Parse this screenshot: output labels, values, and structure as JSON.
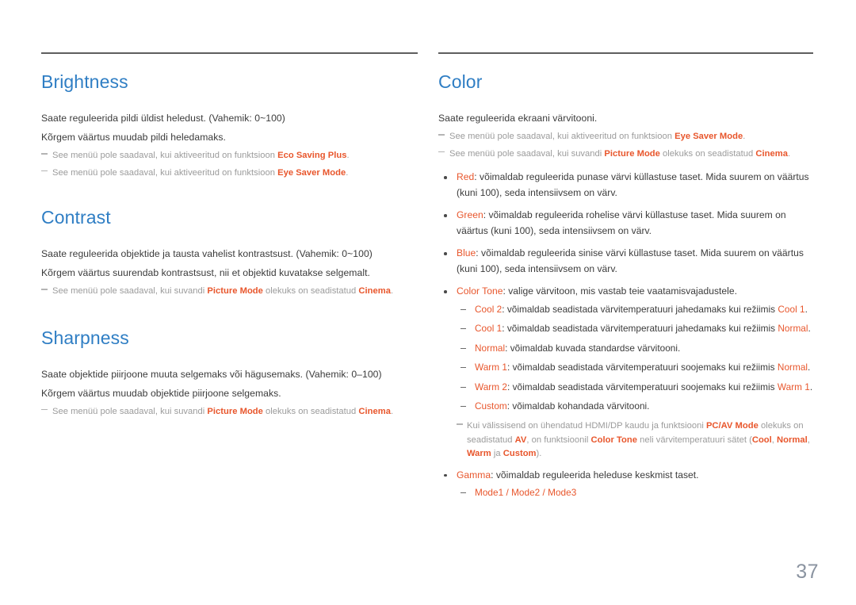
{
  "page": {
    "number": "37",
    "accent_blue": "#2f7ec4",
    "accent_orange": "#e8562c",
    "note_gray": "#9b9b9b",
    "body_gray": "#3b3b3b"
  },
  "left_column": {
    "sections": [
      {
        "title": "Brightness",
        "lines": [
          "Saate reguleerida pildi üldist heledust. (Vahemik: 0~100)",
          "Kõrgem väärtus muudab pildi heledamaks."
        ],
        "notes": [
          {
            "pre": "See menüü pole saadaval, kui aktiveeritud on funktsioon ",
            "kw": "Eco Saving Plus",
            "post": "."
          },
          {
            "pre": "See menüü pole saadaval, kui aktiveeritud on funktsioon ",
            "kw": "Eye Saver Mode",
            "post": "."
          }
        ]
      },
      {
        "title": "Contrast",
        "lines": [
          "Saate reguleerida objektide ja tausta vahelist kontrastsust. (Vahemik: 0~100)",
          "Kõrgem väärtus suurendab kontrastsust, nii et objektid kuvatakse selgemalt."
        ],
        "notes": [
          {
            "pre": "See menüü pole saadaval, kui suvandi ",
            "kw": "Picture Mode",
            "mid": " olekuks on seadistatud ",
            "kw2": "Cinema",
            "post": "."
          }
        ]
      },
      {
        "title": "Sharpness",
        "lines": [
          "Saate objektide piirjoone muuta selgemaks või hägusemaks. (Vahemik: 0–100)",
          "Kõrgem väärtus muudab objektide piirjoone selgemaks."
        ],
        "notes": [
          {
            "pre": "See menüü pole saadaval, kui suvandi ",
            "kw": "Picture Mode",
            "mid": " olekuks on seadistatud ",
            "kw2": "Cinema",
            "post": "."
          }
        ]
      }
    ]
  },
  "right_column": {
    "title": "Color",
    "intro": "Saate reguleerida ekraani värvitooni.",
    "notes": [
      {
        "pre": "See menüü pole saadaval, kui aktiveeritud on funktsioon ",
        "kw": "Eye Saver Mode",
        "post": "."
      },
      {
        "pre": "See menüü pole saadaval, kui suvandi ",
        "kw": "Picture Mode",
        "mid": " olekuks on seadistatud ",
        "kw2": "Cinema",
        "post": "."
      }
    ],
    "bullets": [
      {
        "kw": "Red",
        "text": ": võimaldab reguleerida punase värvi küllastuse taset. Mida suurem on väärtus (kuni 100), seda intensiivsem on värv."
      },
      {
        "kw": "Green",
        "text": ": võimaldab reguleerida rohelise värvi küllastuse taset. Mida suurem on väärtus (kuni 100), seda intensiivsem on värv."
      },
      {
        "kw": "Blue",
        "text": ": võimaldab reguleerida sinise värvi küllastuse taset. Mida suurem on väärtus (kuni 100), seda intensiivsem on värv."
      }
    ],
    "color_tone": {
      "kw": "Color Tone",
      "text": ": valige värvitoon, mis vastab teie vaatamisvajadustele.",
      "subs": [
        {
          "kw": "Cool 2",
          "mid": ": võimaldab seadistada värvitemperatuuri jahedamaks kui režiimis ",
          "kw2": "Cool 1",
          "post": "."
        },
        {
          "kw": "Cool 1",
          "mid": ": võimaldab seadistada värvitemperatuuri jahedamaks kui režiimis ",
          "kw2": "Normal",
          "post": "."
        },
        {
          "kw": "Normal",
          "mid": ": võimaldab kuvada standardse värvitooni.",
          "kw2": "",
          "post": ""
        },
        {
          "kw": "Warm 1",
          "mid": ": võimaldab seadistada värvitemperatuuri soojemaks kui režiimis ",
          "kw2": "Normal",
          "post": "."
        },
        {
          "kw": "Warm 2",
          "mid": ": võimaldab seadistada värvitemperatuuri soojemaks kui režiimis ",
          "kw2": "Warm 1",
          "post": "."
        },
        {
          "kw": "Custom",
          "mid": ": võimaldab kohandada värvitooni.",
          "kw2": "",
          "post": ""
        }
      ],
      "note": {
        "p1": "Kui välissisend on ühendatud HDMI/DP kaudu ja funktsiooni ",
        "k1": "PC/AV Mode",
        "p2": " olekuks on seadistatud ",
        "k2": "AV",
        "p3": ", on funktsioonil ",
        "k3": "Color Tone",
        "p4": " neli värvitemperatuuri sätet (",
        "k4": "Cool",
        "p5": ", ",
        "k5": "Normal",
        "p6": ", ",
        "k6": "Warm",
        "p7": " ja ",
        "k7": "Custom",
        "p8": ")."
      }
    },
    "gamma": {
      "kw": "Gamma",
      "text": ": võimaldab reguleerida heleduse keskmist taset.",
      "modes": "Mode1 / Mode2 / Mode3"
    }
  }
}
